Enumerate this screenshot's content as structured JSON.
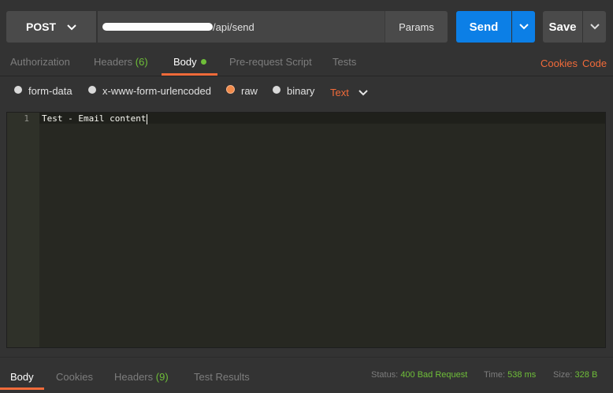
{
  "request": {
    "method": "POST",
    "url_visible": "/api/send",
    "params_label": "Params",
    "send_label": "Send",
    "save_label": "Save"
  },
  "tabs": [
    {
      "label": "Authorization"
    },
    {
      "label": "Headers",
      "count": "(6)"
    },
    {
      "label": "Body"
    },
    {
      "label": "Pre-request Script"
    },
    {
      "label": "Tests"
    }
  ],
  "links": {
    "cookies": "Cookies",
    "code": "Code"
  },
  "body_types": [
    {
      "label": "form-data",
      "selected": false
    },
    {
      "label": "x-www-form-urlencoded",
      "selected": false
    },
    {
      "label": "raw",
      "selected": true
    },
    {
      "label": "binary",
      "selected": false
    }
  ],
  "raw_format": "Text",
  "editor": {
    "line_number": "1",
    "content": "Test - Email content"
  },
  "response_tabs": [
    {
      "label": "Body"
    },
    {
      "label": "Cookies"
    },
    {
      "label": "Headers",
      "count": "(9)"
    },
    {
      "label": "Test Results"
    }
  ],
  "status": {
    "status_label": "Status:",
    "status_value": "400 Bad Request",
    "time_label": "Time:",
    "time_value": "538 ms",
    "size_label": "Size:",
    "size_value": "328 B"
  },
  "colors": {
    "accent": "#f26b3a",
    "send_blue": "#0c7fe6",
    "status_green": "#6fbf39"
  },
  "icons": [
    "chevron-down-icon",
    "status-dot-icon",
    "radio-icon"
  ]
}
